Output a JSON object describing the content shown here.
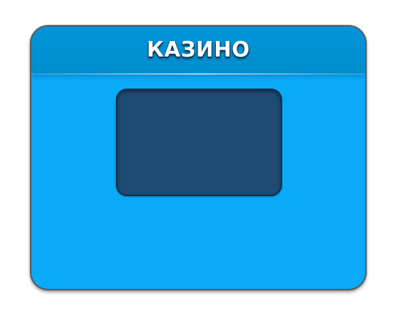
{
  "panel": {
    "title": "КАЗИНО"
  },
  "colors": {
    "panel_body": "#0aaaf8",
    "panel_header": "#0090d2",
    "content_slot": "#1d4b74",
    "border": "#555a5e"
  }
}
